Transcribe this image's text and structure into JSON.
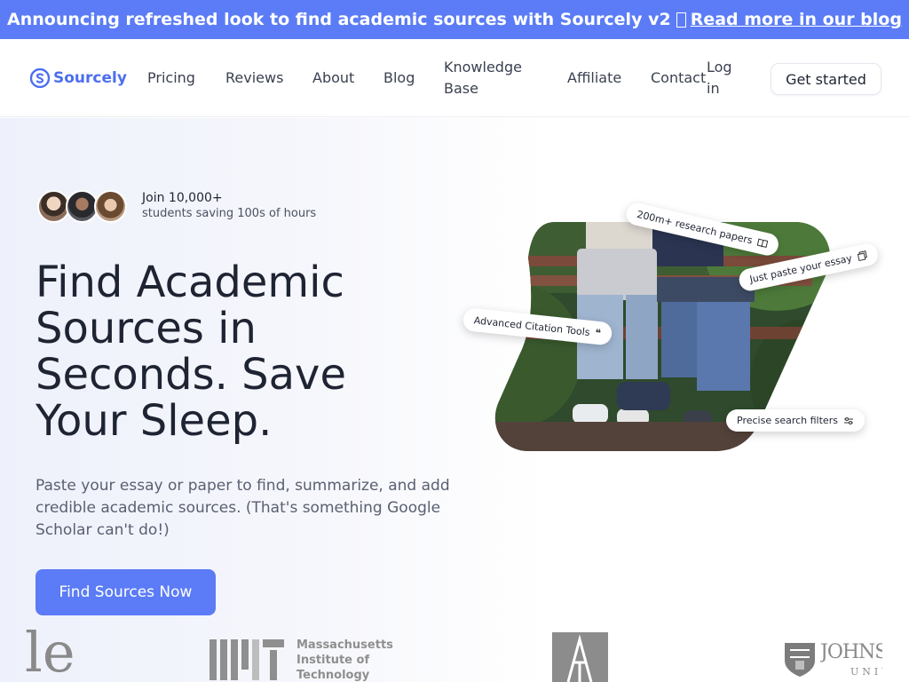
{
  "announcement": {
    "text": "Announcing refreshed look to find academic sources with Sourcely v2",
    "link_text": "Read more in our blog"
  },
  "nav": {
    "brand": "Sourcely",
    "links": [
      "Pricing",
      "Reviews",
      "About",
      "Blog",
      "Knowledge Base",
      "Affiliate",
      "Contact",
      "Log in"
    ],
    "cta": "Get started"
  },
  "hero": {
    "join_title": "Join 10,000+",
    "join_sub": "students saving 100s of hours",
    "headline": "Find Academic Sources in Seconds. Save Your Sleep.",
    "subtext": "Paste your essay or paper to find, summarize, and add credible academic sources. (That's something Google Scholar can't do!)",
    "cta": "Find Sources Now",
    "pills": {
      "papers": "200m+ research papers",
      "paste": "Just paste your essay",
      "citation": "Advanced Citation Tools",
      "filters": "Precise search filters"
    }
  },
  "logos": {
    "mit": [
      "Massachusetts",
      "Institute of",
      "Technology"
    ],
    "left_fragment": "le",
    "johns": "JOHNS",
    "johns_sub": "UNIV"
  },
  "colors": {
    "accent": "#5b7cf6",
    "announce_bg": "#5b7cf6",
    "brand": "#4c6ef0"
  }
}
